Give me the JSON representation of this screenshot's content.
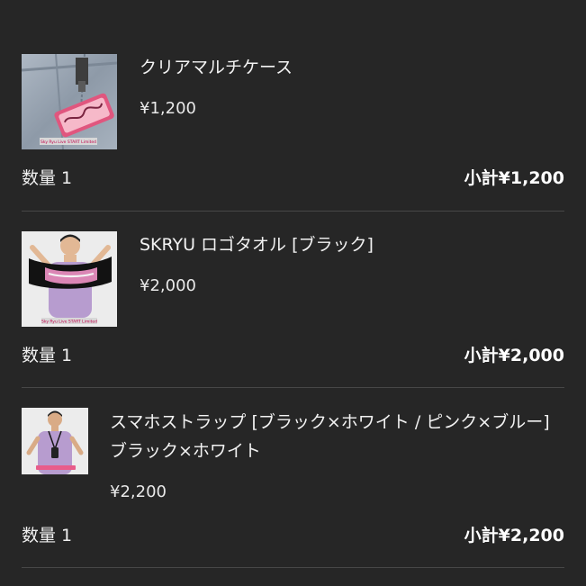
{
  "cart": {
    "items": [
      {
        "name": "クリアマルチケース",
        "price": "¥1,200",
        "qty_label": "数量",
        "qty": "1",
        "subtotal_label": "小計",
        "subtotal": "¥1,200",
        "image_caption": "Sky Ryu Live START Limited"
      },
      {
        "name": "SKRYU ロゴタオル [ブラック]",
        "price": "¥2,000",
        "qty_label": "数量",
        "qty": "1",
        "subtotal_label": "小計",
        "subtotal": "¥2,000",
        "image_caption": "Sky Ryu Live START Limited"
      },
      {
        "name": "スマホストラップ [ブラック×ホワイト / ピンク×ブルー]　ブラック×ホワイト",
        "price": "¥2,200",
        "qty_label": "数量",
        "qty": "1",
        "subtotal_label": "小計",
        "subtotal": "¥2,200"
      }
    ]
  }
}
